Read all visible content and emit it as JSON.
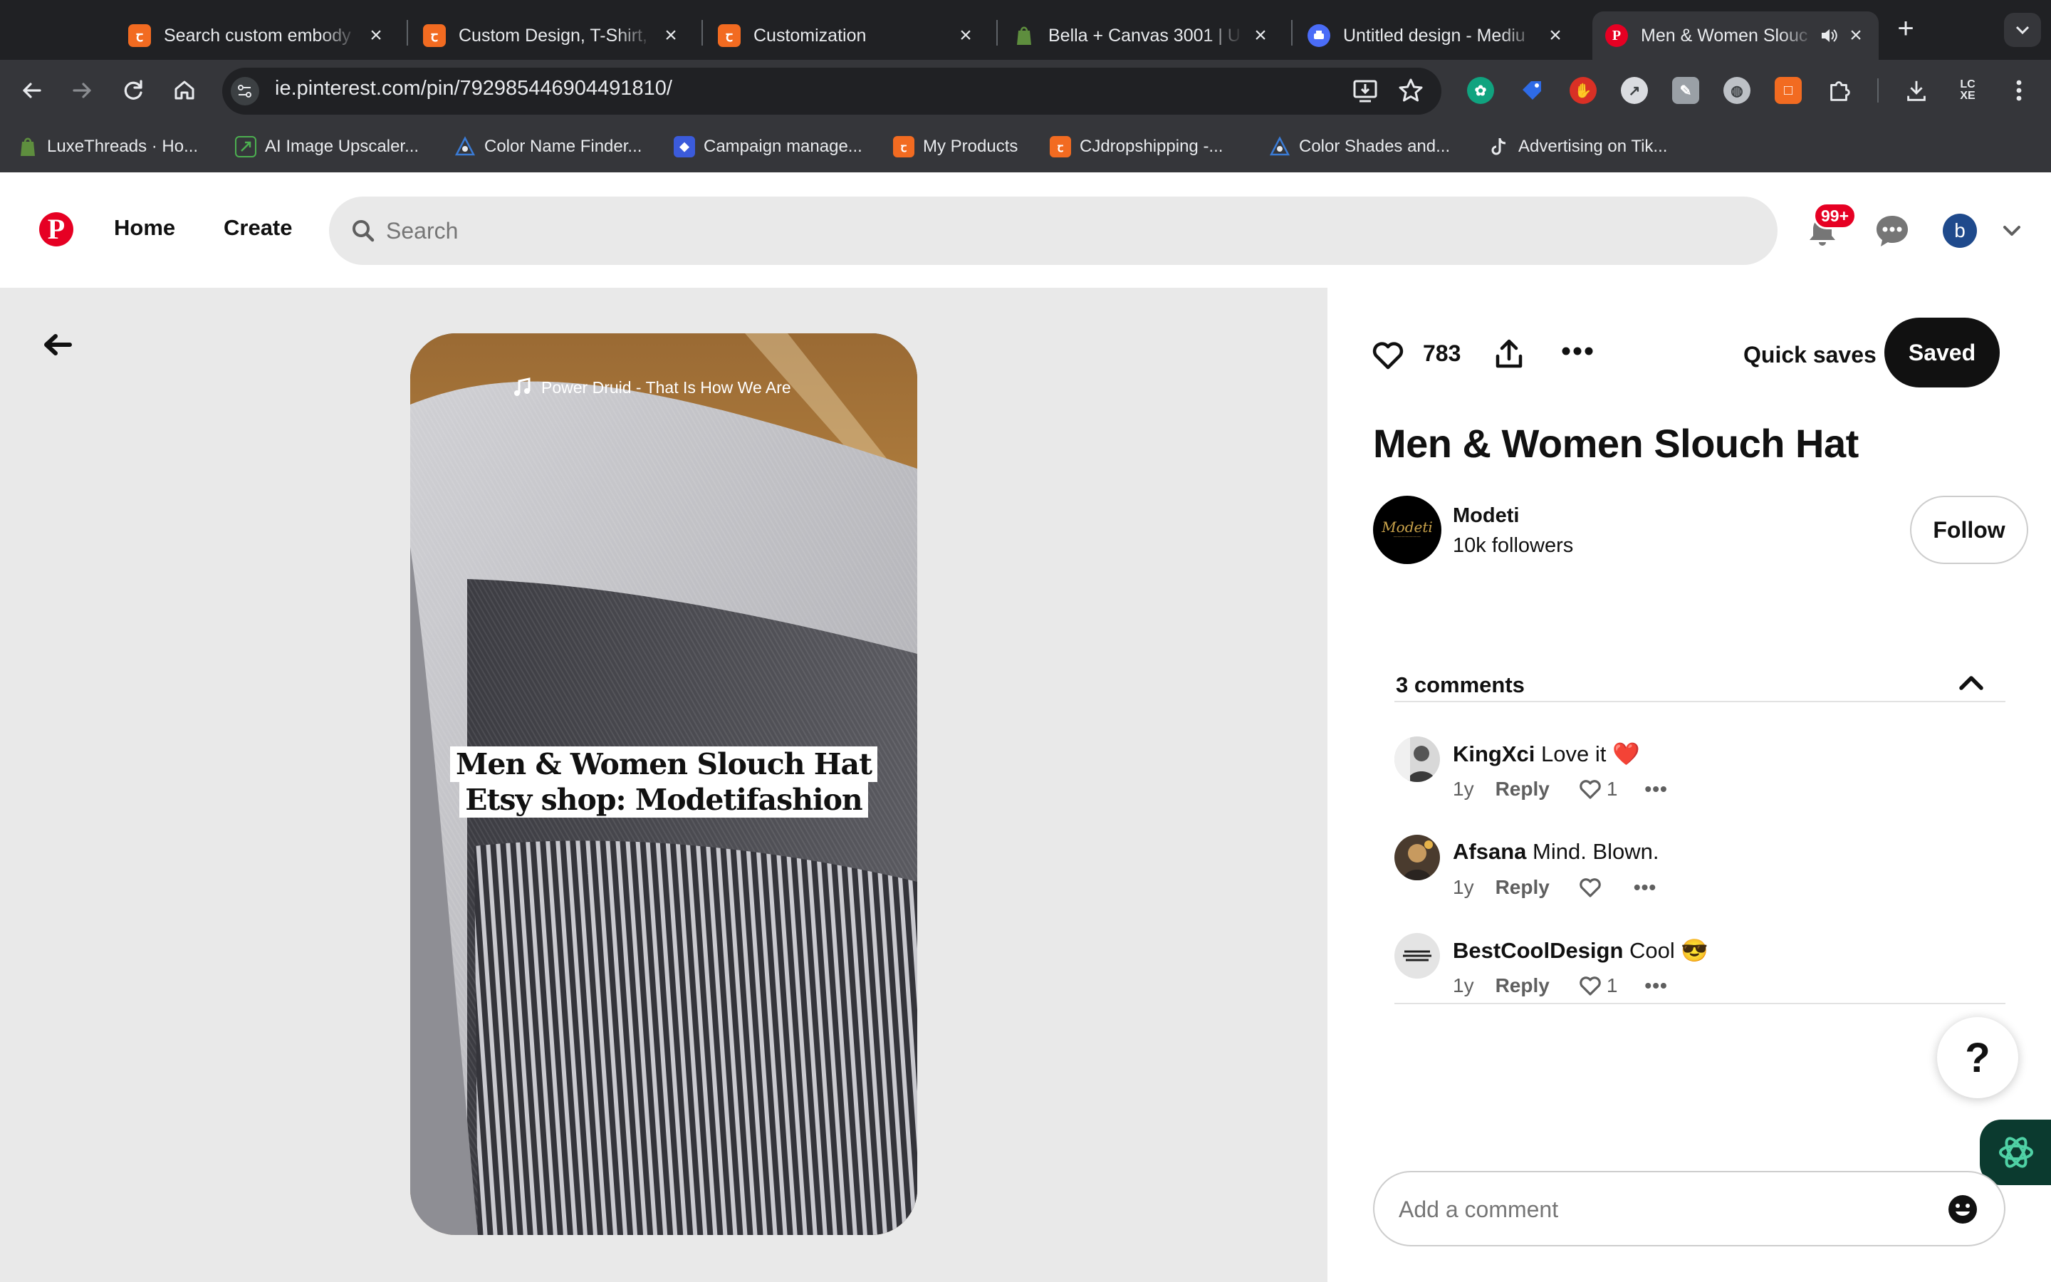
{
  "browser": {
    "tabs": [
      {
        "title": "Search custom embody",
        "icon": "cj-icon",
        "color": "#f26b21"
      },
      {
        "title": "Custom Design, T-Shirt,",
        "icon": "cj-icon",
        "color": "#f26b21"
      },
      {
        "title": "Customization",
        "icon": "cj-icon",
        "color": "#f26b21"
      },
      {
        "title": "Bella + Canvas 3001 | U",
        "icon": "shopify-icon",
        "color": "#5e8e3e"
      },
      {
        "title": "Untitled design - Mediu",
        "icon": "printer-icon",
        "color": "#4a6cf7"
      },
      {
        "title": "Men & Women Slouc",
        "icon": "pinterest-icon",
        "color": "#e60023"
      }
    ],
    "url": "ie.pinterest.com/pin/792985446904491810/",
    "bookmarks": [
      {
        "label": "LuxeThreads · Ho...",
        "icon": "shopify-icon",
        "color": "#5e8e3e"
      },
      {
        "label": "AI Image Upscaler...",
        "icon": "upscale-icon",
        "color": "#4caf50"
      },
      {
        "label": "Color Name Finder...",
        "icon": "color-icon",
        "color": "#3a7bd5"
      },
      {
        "label": "Campaign manage...",
        "icon": "campaign-icon",
        "color": "#3b5bdb"
      },
      {
        "label": "My Products",
        "icon": "cj-icon",
        "color": "#f26b21"
      },
      {
        "label": "CJdropshipping -...",
        "icon": "cj-icon",
        "color": "#f26b21"
      },
      {
        "label": "Color Shades and...",
        "icon": "color-icon",
        "color": "#3a7bd5"
      },
      {
        "label": "Advertising on Tik...",
        "icon": "tiktok-icon",
        "color": "#111111"
      }
    ]
  },
  "header": {
    "nav_home": "Home",
    "nav_create": "Create",
    "search_placeholder": "Search",
    "notifications_badge": "99+",
    "user_initial": "b",
    "accent": "#e60023"
  },
  "pin": {
    "music": "Power Druid - That Is How We Are",
    "caption_line1": "Men & Women Slouch Hat",
    "caption_line2": "Etsy shop: Modetifashion"
  },
  "details": {
    "reaction_count": "783",
    "quick_saves": "Quick saves",
    "saved_label": "Saved",
    "title": "Men & Women Slouch Hat",
    "creator_logo": "Modeti",
    "creator_name": "Modeti",
    "creator_followers": "10k followers",
    "follow_label": "Follow",
    "comments_header": "3 comments"
  },
  "comments": [
    {
      "user": "KingXci",
      "text": "Love it ❤️",
      "age": "1y",
      "reply": "Reply",
      "likes": "1"
    },
    {
      "user": "Afsana",
      "text": "Mind. Blown.",
      "age": "1y",
      "reply": "Reply",
      "likes": ""
    },
    {
      "user": "BestCoolDesign",
      "text": "Cool 😎",
      "age": "1y",
      "reply": "Reply",
      "likes": "1"
    }
  ],
  "add_comment_placeholder": "Add a comment",
  "help_label": "?"
}
